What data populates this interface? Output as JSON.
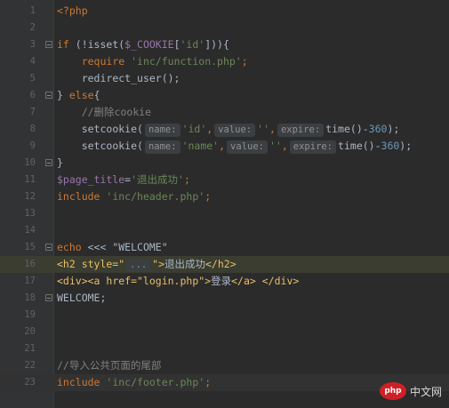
{
  "lines": [
    {
      "n": "1"
    },
    {
      "n": "2"
    },
    {
      "n": "3"
    },
    {
      "n": "4"
    },
    {
      "n": "5"
    },
    {
      "n": "6"
    },
    {
      "n": "7"
    },
    {
      "n": "8"
    },
    {
      "n": "9"
    },
    {
      "n": "10"
    },
    {
      "n": "11"
    },
    {
      "n": "12"
    },
    {
      "n": "13"
    },
    {
      "n": "14"
    },
    {
      "n": "15"
    },
    {
      "n": "16"
    },
    {
      "n": "17"
    },
    {
      "n": "18"
    },
    {
      "n": "19"
    },
    {
      "n": "20"
    },
    {
      "n": "21"
    },
    {
      "n": "22"
    },
    {
      "n": "23"
    }
  ],
  "code": {
    "l1_php_open": "<?php",
    "l3_if": "if",
    "l3_not_isset": " (!isset(",
    "l3_cookie": "$_COOKIE",
    "l3_idx": "[",
    "l3_id_str": "'id'",
    "l3_close": "])){",
    "l4_require": "require",
    "l4_path": "'inc/function.php'",
    "l4_semi": ";",
    "l5_call": "redirect_user();",
    "l6_brace": "} ",
    "l6_else": "else",
    "l6_open": "{",
    "l7_comment": "//删除cookie",
    "l8_setcookie": "setcookie(",
    "hint_name": "name:",
    "hint_value": "value:",
    "hint_expire": "expire:",
    "l8_id": "'id'",
    "comma": ",",
    "empty_str": "''",
    "l8_time": "time()-",
    "l8_num": "360",
    "l8_end": ");",
    "l9_name": "'name'",
    "l10_brace": "}",
    "l11_var": "$page_title",
    "l11_eq": "=",
    "l11_str": "'退出成功'",
    "l11_semi": ";",
    "l12_include": "include",
    "l12_path": "'inc/header.php'",
    "l12_semi": ";",
    "l15_echo": "echo",
    "l15_heredoc": " <<< \"WELCOME\"",
    "l16_open": "<h2 style=\"",
    "l16_dots": "...",
    "l16_mid": "\">",
    "l16_text": "退出成功",
    "l16_close": "</h2>",
    "l17_div": "<div>",
    "l17_a": "<a href=\"login.php\">",
    "l17_text": "登录",
    "l17_a_close": "</a>",
    "l17_div_close": "</div>",
    "l18_welcome": "WELCOME;",
    "l22_comment": "//导入公共页面的尾部",
    "l23_include": "include",
    "l23_path": "'inc/footer.php'",
    "l23_semi": ";"
  },
  "watermark": {
    "logo": "php",
    "text": "中文网"
  }
}
